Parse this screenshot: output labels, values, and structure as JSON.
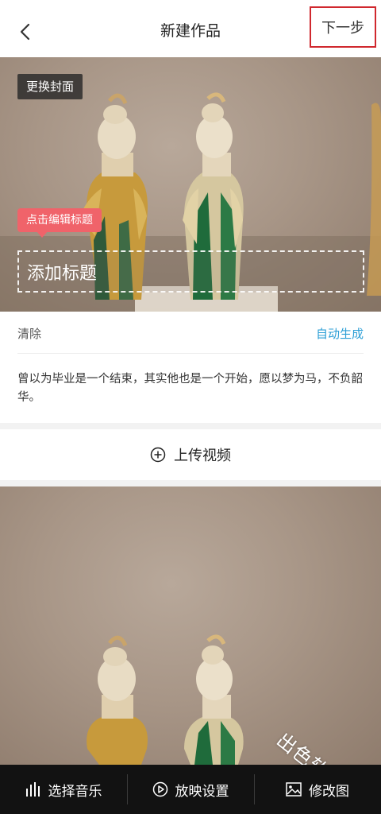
{
  "header": {
    "title": "新建作品",
    "back_icon": "chevron-left-icon",
    "next_label": "下一步"
  },
  "cover": {
    "change_cover_label": "更换封面",
    "tip_label": "点击编辑标题",
    "title_placeholder": "添加标题"
  },
  "panel": {
    "clear_label": "清除",
    "auto_generate_label": "自动生成",
    "description": "曾以为毕业是一个结束，其实他也是一个开始，愿以梦为马，不负韶华。"
  },
  "upload": {
    "icon": "plus-circle-icon",
    "label": "上传视频"
  },
  "toolbar": {
    "items": [
      {
        "icon": "music-bars-icon",
        "label": "选择音乐"
      },
      {
        "icon": "play-circle-icon",
        "label": "放映设置"
      },
      {
        "icon": "image-icon",
        "label": "修改图"
      }
    ]
  },
  "watermark": "出色软件园",
  "colors": {
    "accent_blue": "#2c9fd6",
    "tip_red": "#f0636a",
    "highlight_border": "#d0282e",
    "toolbar_bg": "#121212"
  }
}
